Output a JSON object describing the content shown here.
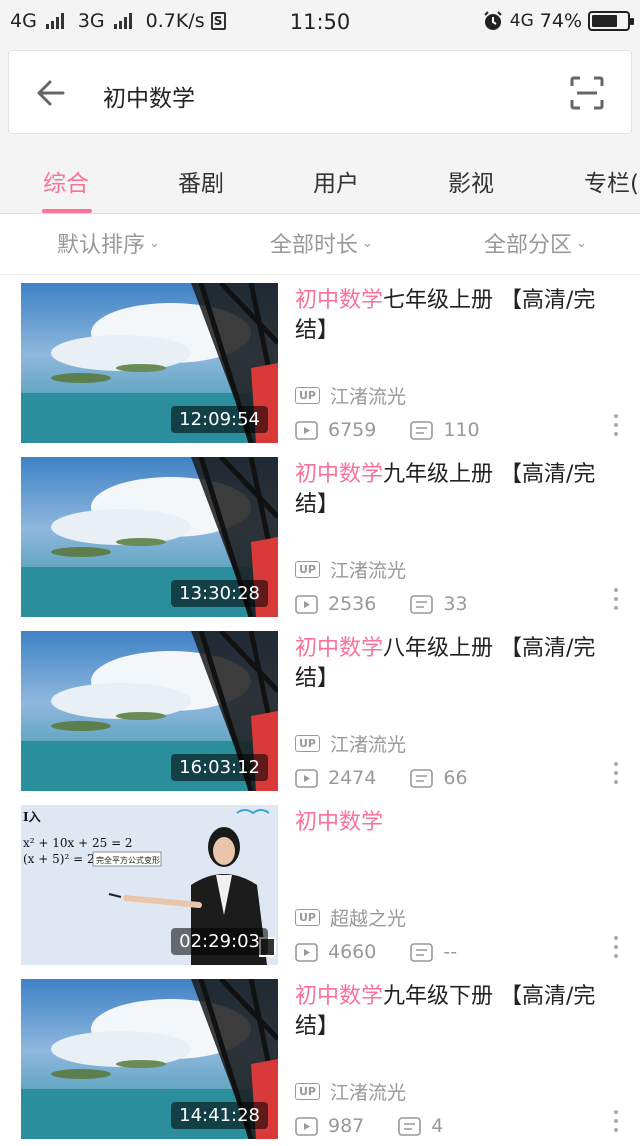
{
  "status_bar": {
    "net1": "4G",
    "net2": "3G",
    "speed": "0.7K/s",
    "s_icon": "S",
    "time": "11:50",
    "alarm_icon": "alarm-icon",
    "net3": "4G",
    "battery": "74%",
    "battery_level": 0.74
  },
  "search": {
    "back_icon": "arrow-left-icon",
    "query": "初中数学",
    "scan_icon": "scan-icon"
  },
  "tabs": [
    {
      "label": "综合",
      "active": true
    },
    {
      "label": "番剧",
      "active": false
    },
    {
      "label": "用户",
      "active": false
    },
    {
      "label": "影视",
      "active": false
    },
    {
      "label": "专栏(",
      "active": false
    }
  ],
  "filters": [
    {
      "label": "默认排序"
    },
    {
      "label": "全部时长"
    },
    {
      "label": "全部分区"
    }
  ],
  "colors": {
    "accent": "#fb7299",
    "muted": "#999999"
  },
  "videos": [
    {
      "title_hl": "初中数学",
      "title_rest": "七年级上册 【高清/完结】",
      "duration": "12:09:54",
      "uploader": "江渚流光",
      "plays": "6759",
      "danmaku": "110",
      "thumb": "sky"
    },
    {
      "title_hl": "初中数学",
      "title_rest": "九年级上册 【高清/完结】",
      "duration": "13:30:28",
      "uploader": "江渚流光",
      "plays": "2536",
      "danmaku": "33",
      "thumb": "sky"
    },
    {
      "title_hl": "初中数学",
      "title_rest": "八年级上册 【高清/完结】",
      "duration": "16:03:12",
      "uploader": "江渚流光",
      "plays": "2474",
      "danmaku": "66",
      "thumb": "sky"
    },
    {
      "title_hl": "初中数学",
      "title_rest": "",
      "duration": "02:29:03",
      "uploader": "超越之光",
      "plays": "4660",
      "danmaku": "--",
      "thumb": "teacher"
    },
    {
      "title_hl": "初中数学",
      "title_rest": "九年级下册 【高清/完结】",
      "duration": "14:41:28",
      "uploader": "江渚流光",
      "plays": "987",
      "danmaku": "4",
      "thumb": "sky"
    }
  ],
  "labels": {
    "up_badge": "UP",
    "teacher_board_1": "x² + 10x + 25 = 2",
    "teacher_board_2": "(x + 5)² = 2",
    "teacher_board_note": "完全平方公式变形",
    "teacher_board_head": "I入"
  }
}
